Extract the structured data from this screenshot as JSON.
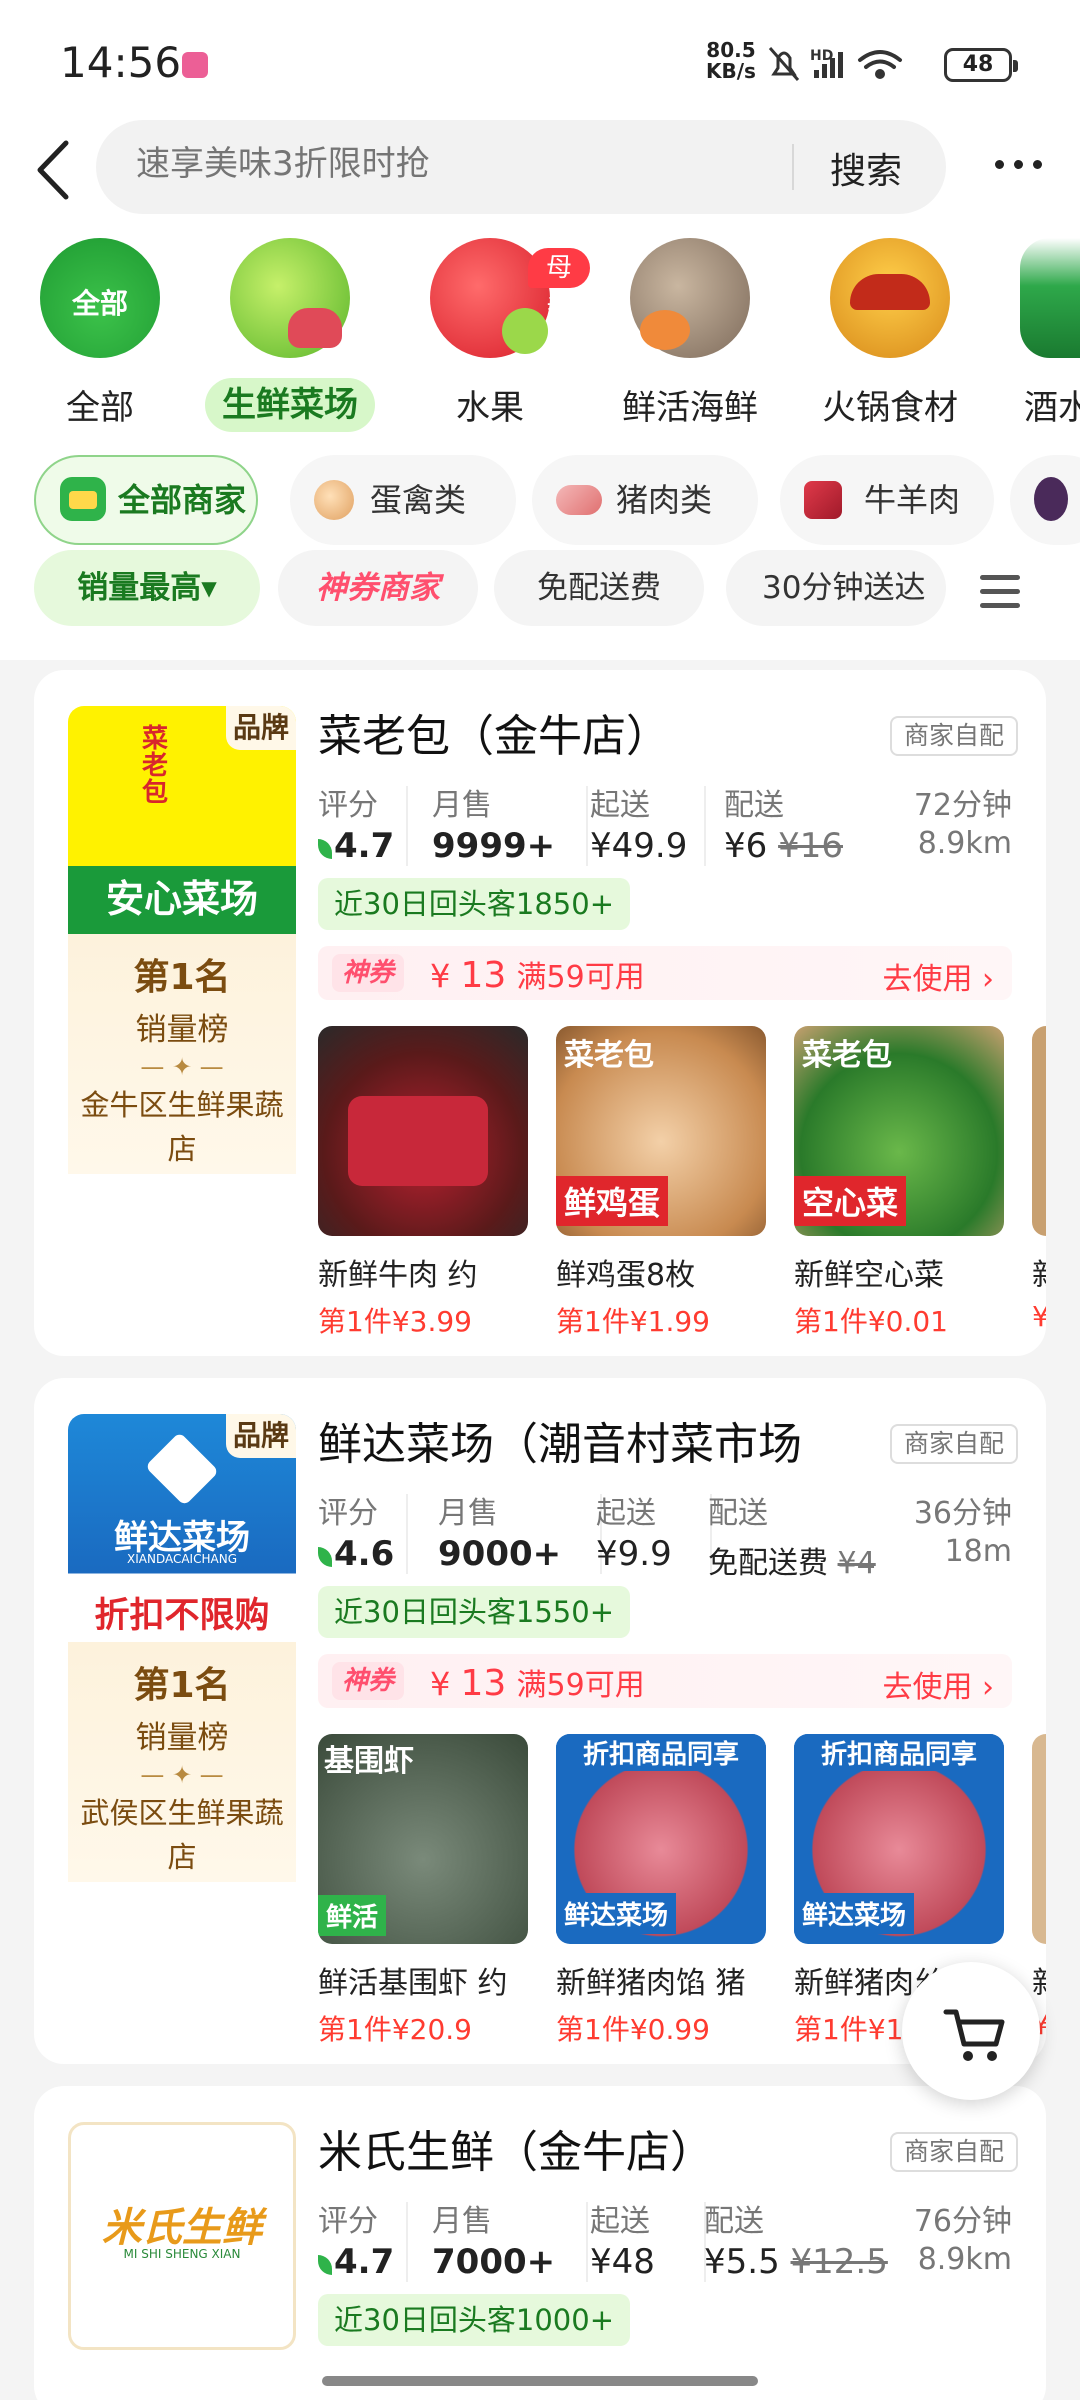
{
  "status_bar": {
    "time": "14:56",
    "speed_top": "80.5",
    "speed_bottom": "KB/s",
    "network": "HD",
    "battery": "48"
  },
  "search": {
    "placeholder": "速享美味3折限时抢",
    "button": "搜索"
  },
  "categories": [
    {
      "label": "全部",
      "icon": "all-basket-icon",
      "img_text": "全部"
    },
    {
      "label": "生鲜菜场",
      "icon": "vegetable-icon",
      "active": true
    },
    {
      "label": "水果",
      "icon": "apple-icon",
      "badge": "母亲节"
    },
    {
      "label": "鲜活海鲜",
      "icon": "fish-icon"
    },
    {
      "label": "火锅食材",
      "icon": "hotpot-icon"
    },
    {
      "label": "酒水",
      "icon": "drink-icon"
    }
  ],
  "chips": [
    {
      "label": "全部商家",
      "icon": "store-icon",
      "active": true
    },
    {
      "label": "蛋禽类",
      "icon": "egg-icon"
    },
    {
      "label": "猪肉类",
      "icon": "pork-icon"
    },
    {
      "label": "牛羊肉",
      "icon": "beef-icon"
    }
  ],
  "filters": [
    {
      "label": "销量最高▾",
      "active": true
    },
    {
      "label": "神券商家",
      "style": "brand"
    },
    {
      "label": "免配送费"
    },
    {
      "label": "30分钟送达"
    }
  ],
  "stores": [
    {
      "name": "菜老包（金牛店）",
      "tag": "商家自配",
      "brand": "品牌",
      "logo_text": "菜老包",
      "logo_banner": "安心菜场",
      "rank_title": "第1名",
      "rank_sub": "销量榜",
      "rank_area": "金牛区生鲜果蔬店",
      "labels": {
        "score": "评分",
        "sales": "月售",
        "min": "起送",
        "delivery": "配送"
      },
      "score": "4.7",
      "sales": "9999+",
      "min_order": "¥49.9",
      "delivery_fee": "¥6",
      "delivery_fee_orig": "¥16",
      "time": "72分钟",
      "distance": "8.9km",
      "repeat": "近30日回头客1850+",
      "coupon_tag": "神券",
      "coupon_amount": "¥",
      "coupon_value": "13",
      "coupon_cond": "满59可用",
      "coupon_action": "去使用 ›",
      "products": [
        {
          "name": "新鲜牛肉 约",
          "price": "第1件¥3.99"
        },
        {
          "name": "鲜鸡蛋8枚",
          "price": "第1件¥1.99",
          "img_top": "菜老包",
          "img_label": "鲜鸡蛋"
        },
        {
          "name": "新鲜空心菜",
          "price": "第1件¥0.01",
          "img_top": "菜老包",
          "img_label": "空心菜"
        },
        {
          "name": "新",
          "price": "¥"
        }
      ]
    },
    {
      "name": "鲜达菜场（潮音村菜市场",
      "tag": "商家自配",
      "brand": "品牌",
      "logo_text": "鲜达菜场",
      "logo_sub": "XIANDACAICHANG",
      "logo_banner": "折扣不限购",
      "rank_title": "第1名",
      "rank_sub": "销量榜",
      "rank_area": "武侯区生鲜果蔬店",
      "labels": {
        "score": "评分",
        "sales": "月售",
        "min": "起送",
        "delivery": "配送"
      },
      "score": "4.6",
      "sales": "9000+",
      "min_order": "¥9.9",
      "delivery_fee": "免配送费",
      "delivery_fee_orig": "¥4",
      "time": "36分钟",
      "distance": "18m",
      "repeat": "近30日回头客1550+",
      "coupon_tag": "神券",
      "coupon_amount": "¥",
      "coupon_value": "13",
      "coupon_cond": "满59可用",
      "coupon_action": "去使用 ›",
      "products": [
        {
          "name": "鲜活基围虾 约",
          "price": "第1件¥20.9",
          "img_top": "基围虾",
          "img_label": "鲜活"
        },
        {
          "name": "新鲜猪肉馅 猪",
          "price": "第1件¥0.99",
          "img_top": "折扣商品同享",
          "img_label": "鲜达菜场"
        },
        {
          "name": "新鲜猪肉丝 约",
          "price": "第1件¥1.",
          "img_top": "折扣商品同享",
          "img_label": "鲜达菜场"
        },
        {
          "name": "新",
          "price": "¥"
        }
      ]
    },
    {
      "name": "米氏生鲜（金牛店）",
      "tag": "商家自配",
      "logo_text": "米氏生鲜",
      "logo_sub": "MI SHI SHENG XIAN",
      "labels": {
        "score": "评分",
        "sales": "月售",
        "min": "起送",
        "delivery": "配送"
      },
      "score": "4.7",
      "sales": "7000+",
      "min_order": "¥48",
      "delivery_fee": "¥5.5",
      "delivery_fee_orig": "¥12.5",
      "time": "76分钟",
      "distance": "8.9km",
      "repeat": "近30日回头客1000+"
    }
  ],
  "colors": {
    "accent_green": "#1a7a20",
    "price_red": "#ff3b30",
    "coupon_pink": "#ff4f6e"
  }
}
